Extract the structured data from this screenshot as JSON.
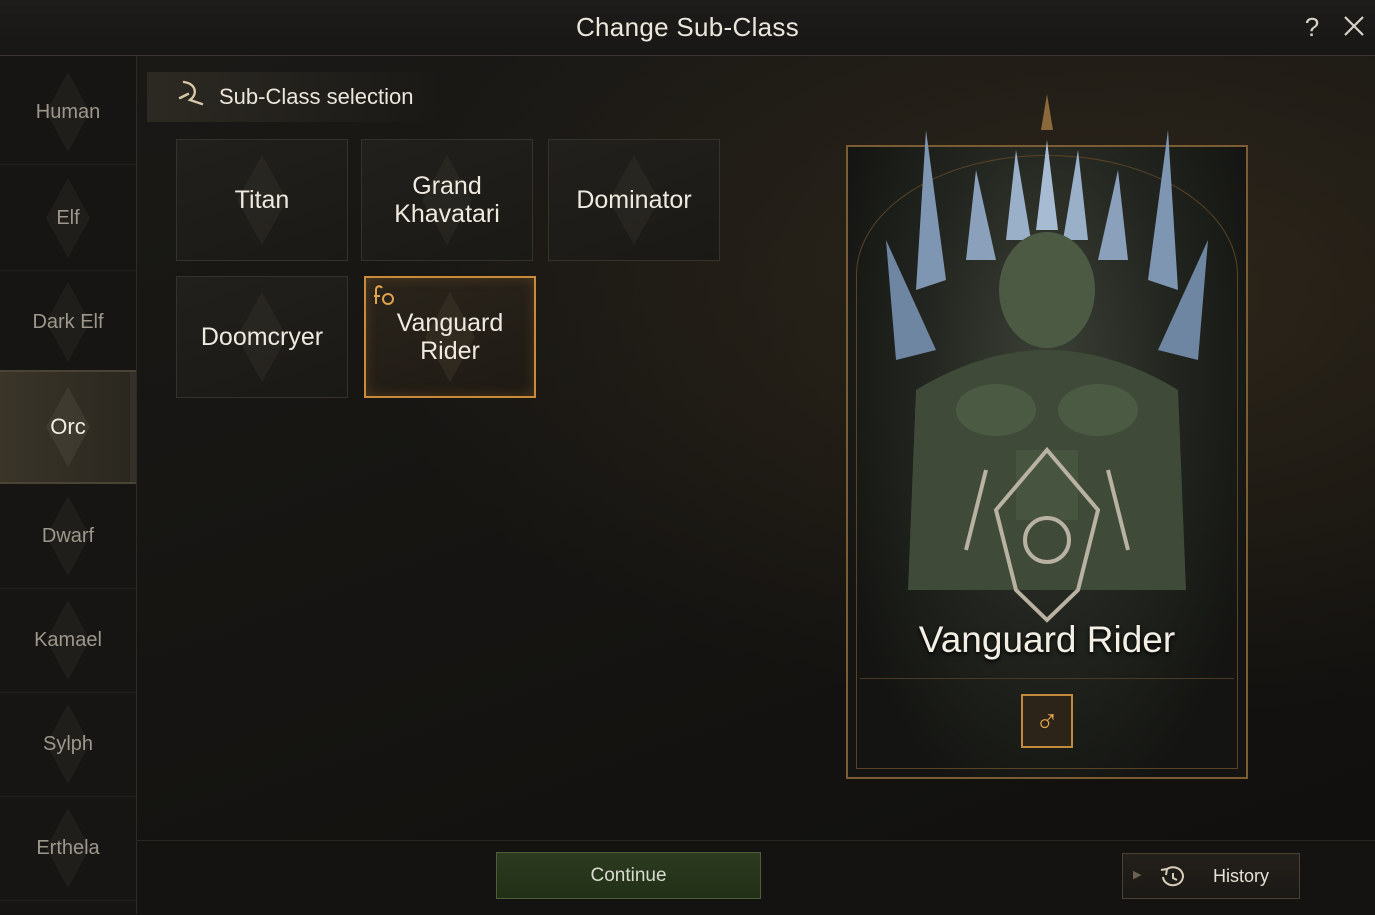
{
  "window": {
    "title": "Change Sub-Class",
    "help_label": "?",
    "close_icon": "close-icon"
  },
  "sidebar": {
    "items": [
      {
        "label": "Human",
        "active": false
      },
      {
        "label": "Elf",
        "active": false
      },
      {
        "label": "Dark Elf",
        "active": false
      },
      {
        "label": "Orc",
        "active": true
      },
      {
        "label": "Dwarf",
        "active": false
      },
      {
        "label": "Kamael",
        "active": false
      },
      {
        "label": "Sylph",
        "active": false
      },
      {
        "label": "Erthela",
        "active": false
      }
    ]
  },
  "selection": {
    "title": "Sub-Class selection",
    "icon": "sickle-icon",
    "classes": [
      {
        "label": "Titan",
        "selected": false
      },
      {
        "label": "Grand\nKhavatari",
        "selected": false
      },
      {
        "label": "Dominator",
        "selected": false
      },
      {
        "label": "Doomcryer",
        "selected": false
      },
      {
        "label": "Vanguard Rider",
        "selected": true,
        "badge": "mount-icon"
      }
    ]
  },
  "preview": {
    "name": "Vanguard Rider",
    "gender_symbol": "♂",
    "gender_icon": "male-icon"
  },
  "footer": {
    "continue_label": "Continue",
    "history_label": "History",
    "history_icon": "history-icon"
  },
  "colors": {
    "accent": "#c98a3a",
    "continue_bg": "#2c3a1f",
    "text": "#e6e1d6"
  }
}
